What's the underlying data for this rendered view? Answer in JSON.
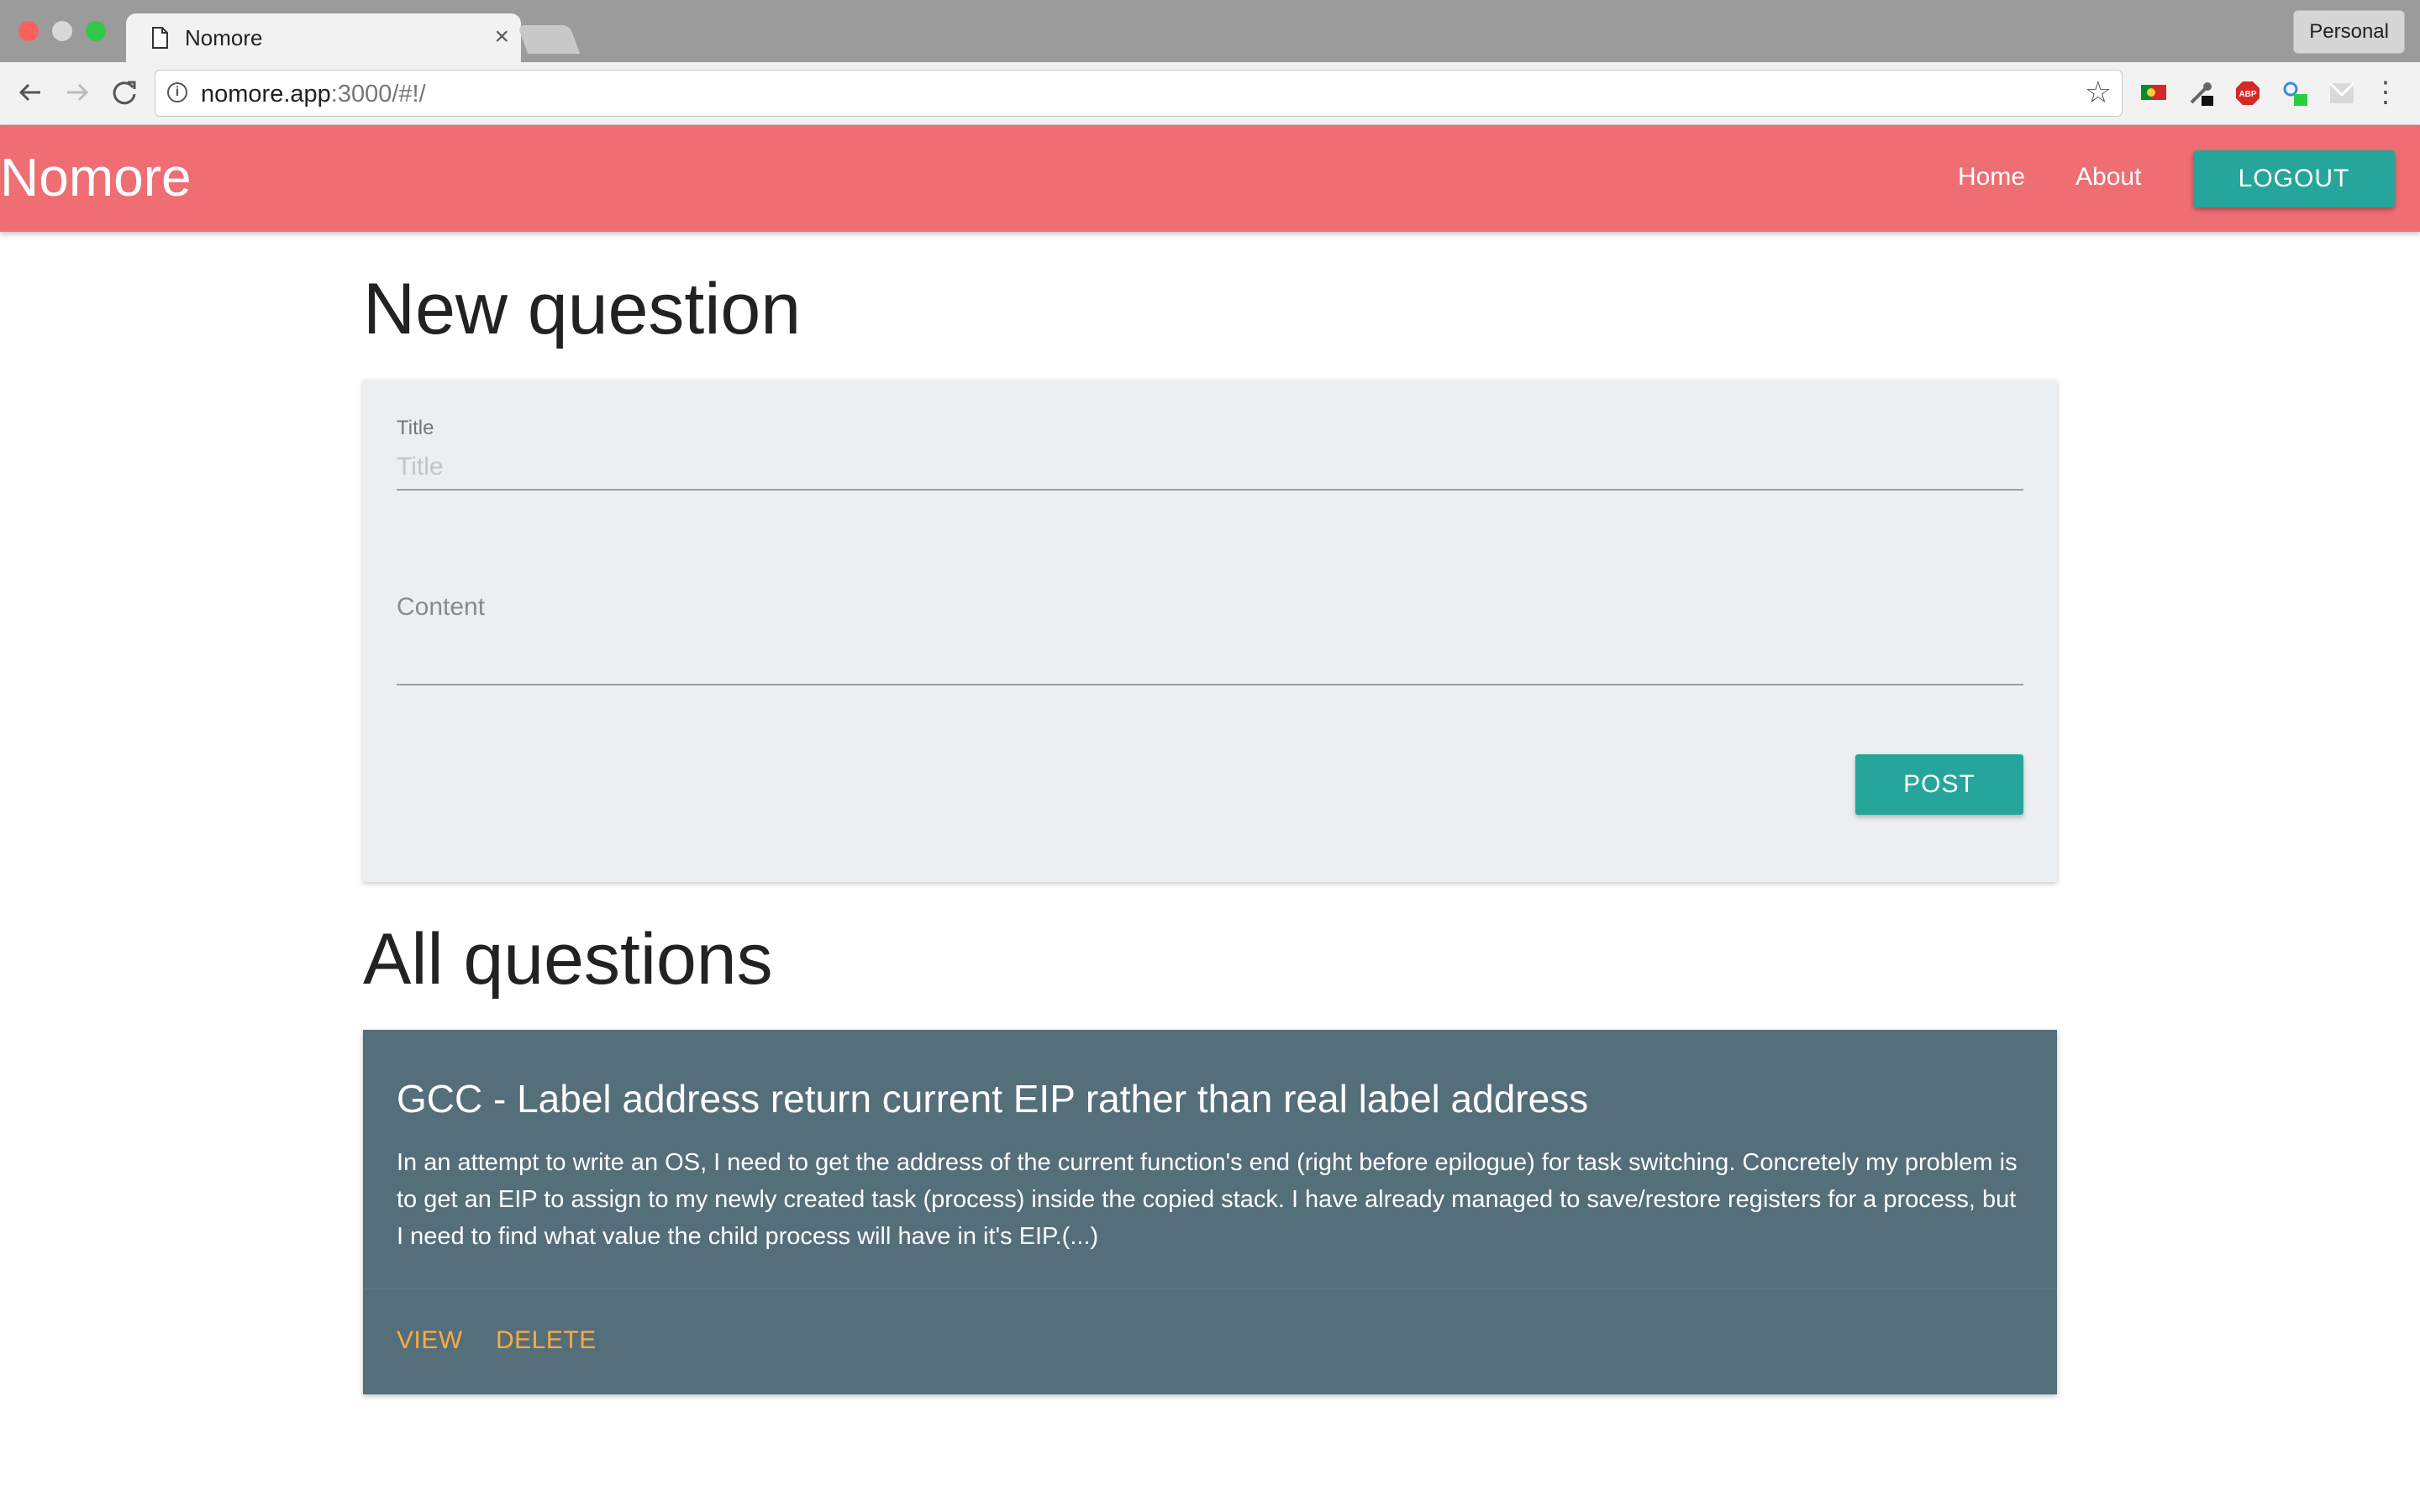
{
  "browser": {
    "tab_title": "Nomore",
    "tab_close": "×",
    "url_host": "nomore.app",
    "url_rest": ":3000/#!/",
    "profile": "Personal",
    "star_glyph": "☆",
    "menu_glyph": "⋮",
    "info_glyph": "i"
  },
  "navbar": {
    "brand": "Nomore",
    "links": [
      "Home",
      "About"
    ],
    "logout": "LOGOUT",
    "color": "#ef6e73"
  },
  "new_question": {
    "heading": "New question",
    "title_label": "Title",
    "title_placeholder": "Title",
    "content_label": "Content",
    "post_button": "POST"
  },
  "all_questions": {
    "heading": "All questions",
    "items": [
      {
        "title": "GCC - Label address return current EIP rather than real label address",
        "excerpt": "In an attempt to write an OS, I need to get the address of the current function's end (right before epilogue) for task switching. Concretely my problem is to get an EIP to assign to my newly created task (process) inside the copied stack. I have already managed to save/restore registers for a process, but I need to find what value the child process will have in it's EIP.(...)",
        "actions": [
          "VIEW",
          "DELETE"
        ]
      }
    ]
  },
  "colors": {
    "accent": "#26a69a",
    "card": "#546e7a",
    "action": "#ffab40"
  }
}
